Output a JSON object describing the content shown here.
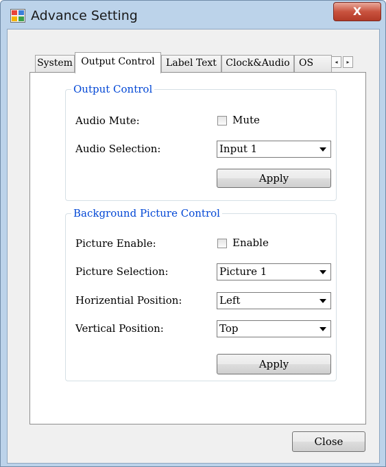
{
  "window": {
    "title": "Advance Setting",
    "close_glyph": "X"
  },
  "tabs": [
    {
      "label": "System"
    },
    {
      "label": "Output Control"
    },
    {
      "label": "Label Text"
    },
    {
      "label": "Clock&Audio"
    },
    {
      "label": "OS"
    }
  ],
  "tab_scroll": {
    "left_glyph": "◂",
    "right_glyph": "▸"
  },
  "output_control": {
    "title": "Output Control",
    "audio_mute_label": "Audio Mute:",
    "mute_checkbox_label": "Mute",
    "mute_checked": false,
    "audio_selection_label": "Audio Selection:",
    "audio_selection_value": "Input 1",
    "apply_label": "Apply"
  },
  "background_picture": {
    "title": "Background Picture Control",
    "picture_enable_label": "Picture Enable:",
    "enable_checkbox_label": "Enable",
    "enable_checked": false,
    "picture_selection_label": "Picture Selection:",
    "picture_selection_value": "Picture 1",
    "horizontal_position_label": "Horizential Position:",
    "horizontal_position_value": "Left",
    "vertical_position_label": "Vertical Position:",
    "vertical_position_value": "Top",
    "apply_label": "Apply"
  },
  "footer": {
    "close_label": "Close"
  },
  "colors": {
    "group_title": "#0046d5",
    "window_frame": "#bcd3ea",
    "close_button": "#c9533f"
  }
}
